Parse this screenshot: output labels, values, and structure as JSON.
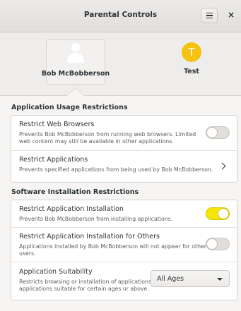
{
  "window": {
    "title": "Parental Controls",
    "menu_icon": "hamburger-menu-icon",
    "close_label": "×"
  },
  "users": [
    {
      "name": "Bob McBobberson",
      "avatar": "person-icon",
      "selected": true
    },
    {
      "name": "Test",
      "avatar_letter": "T",
      "avatar_color": "#f5c211",
      "selected": false
    }
  ],
  "usage_section": {
    "title": "Application Usage Restrictions",
    "rows": [
      {
        "title": "Restrict Web Browsers",
        "subtitle": "Prevents Bob McBobberson from running web browsers. Limited web content may still be available in other applications.",
        "switch_on": false
      },
      {
        "title": "Restrict Applications",
        "subtitle": "Prevents specified applications from being used by Bob McBobberson.",
        "icon": "chevron-right-icon"
      }
    ]
  },
  "install_section": {
    "title": "Software Installation Restrictions",
    "rows": [
      {
        "title": "Restrict Application Installation",
        "subtitle": "Prevents Bob McBobberson from installing applications.",
        "switch_on": true
      },
      {
        "title": "Restrict Application Installation for Others",
        "subtitle": "Applications installed by Bob McBobberson will not appear for other users.",
        "switch_on": false
      },
      {
        "title": "Application Suitability",
        "subtitle": "Restricts browsing or installation of applications to applications suitable for certain ages or above.",
        "select_value": "All Ages"
      }
    ]
  },
  "colors": {
    "accent_switch_on": "#f5e60a",
    "avatar_test": "#f5c211"
  }
}
